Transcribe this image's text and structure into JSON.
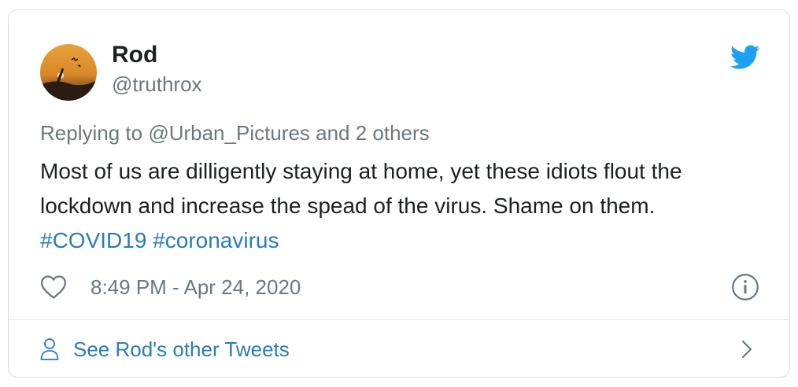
{
  "user": {
    "name": "Rod",
    "handle": "@truthrox"
  },
  "tweet": {
    "replying_prefix": "Replying to ",
    "replying_to": "@Urban_Pictures",
    "replying_suffix": " and 2 others",
    "text": "Most of us are dilligently staying at home, yet these idiots flout the lockdown and increase the spead of the virus. Shame on them. ",
    "hashtags": [
      "#COVID19",
      "#coronavirus"
    ],
    "timestamp": "8:49 PM - Apr 24, 2020"
  },
  "footer": {
    "label": "See Rod's other Tweets"
  },
  "icons": {
    "brand": "twitter-bird-icon",
    "like": "heart-icon",
    "info": "info-icon",
    "profile": "person-icon",
    "more": "chevron-right-icon"
  },
  "colors": {
    "link": "#2b7bb9",
    "secondary_text": "#697882",
    "primary_text": "#1c2022",
    "border": "#d7dce0"
  }
}
